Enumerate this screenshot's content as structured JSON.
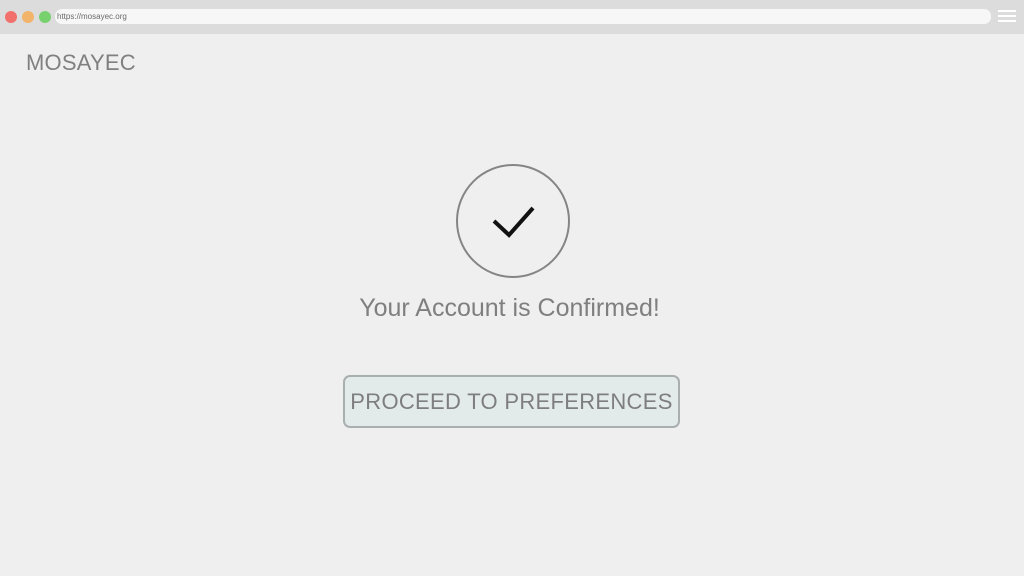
{
  "browser": {
    "url": "https://mosayec.org",
    "controls": [
      "close",
      "minimize",
      "maximize"
    ],
    "menu_icon": "hamburger-menu-icon"
  },
  "header": {
    "brand": "MOSAYEC"
  },
  "main": {
    "status_icon": "checkmark-icon",
    "message": "Your Account is Confirmed!",
    "proceed_label": "PROCEED TO PREFERENCES"
  },
  "colors": {
    "background": "#efefef",
    "text": "#7f7f7f",
    "button_background": "#e3eaea",
    "button_border": "#a9afaf",
    "close": "#f2706b",
    "minimize": "#f2b36b",
    "maximize": "#78d16f"
  }
}
